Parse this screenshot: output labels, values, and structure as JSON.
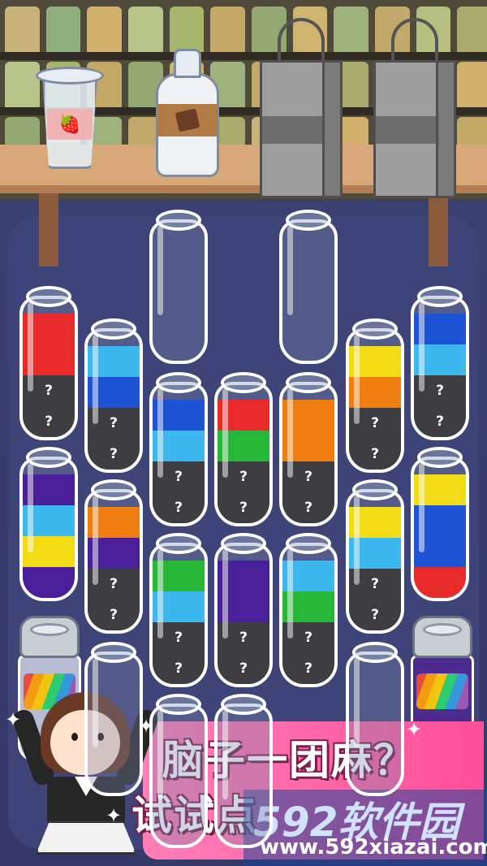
{
  "scene": {
    "shelf_items": [
      "strawberry-cup",
      "chocolate-milk-bottle",
      "shopping-bag",
      "shopping-bag"
    ],
    "colors": {
      "red": "#e82a2a",
      "light_blue": "#3cb8ef",
      "blue": "#1e53d6",
      "green": "#27b83a",
      "orange": "#f07d10",
      "yellow": "#f2dc16",
      "purple": "#4a1f9a",
      "hidden": "#3e3e42"
    }
  },
  "tubes": [
    {
      "id": "t1",
      "segments": [
        {
          "color": "red"
        },
        {
          "color": "red"
        },
        {
          "hidden": true,
          "mark": "?"
        },
        {
          "hidden": true,
          "mark": "?"
        }
      ]
    },
    {
      "id": "t2",
      "segments": [
        {
          "color": "light_blue"
        },
        {
          "color": "blue"
        },
        {
          "hidden": true,
          "mark": "?"
        },
        {
          "hidden": true,
          "mark": "?"
        }
      ]
    },
    {
      "id": "t3",
      "segments": []
    },
    {
      "id": "t4",
      "segments": [
        {
          "color": "blue"
        },
        {
          "color": "light_blue"
        },
        {
          "hidden": true,
          "mark": "?"
        },
        {
          "hidden": true,
          "mark": "?"
        }
      ]
    },
    {
      "id": "t5",
      "segments": [
        {
          "color": "red"
        },
        {
          "color": "green"
        },
        {
          "hidden": true,
          "mark": "?"
        },
        {
          "hidden": true,
          "mark": "?"
        }
      ]
    },
    {
      "id": "t6",
      "segments": []
    },
    {
      "id": "t7",
      "segments": [
        {
          "color": "orange"
        },
        {
          "color": "orange"
        },
        {
          "hidden": true,
          "mark": "?"
        },
        {
          "hidden": true,
          "mark": "?"
        }
      ]
    },
    {
      "id": "t8",
      "segments": [
        {
          "color": "yellow"
        },
        {
          "color": "orange"
        },
        {
          "hidden": true,
          "mark": "?"
        },
        {
          "hidden": true,
          "mark": "?"
        }
      ]
    },
    {
      "id": "t9",
      "segments": [
        {
          "color": "blue"
        },
        {
          "color": "light_blue"
        },
        {
          "hidden": true,
          "mark": "?"
        },
        {
          "hidden": true,
          "mark": "?"
        }
      ]
    },
    {
      "id": "t10",
      "segments": [
        {
          "color": "purple"
        },
        {
          "color": "light_blue"
        },
        {
          "color": "yellow"
        },
        {
          "color": "purple"
        }
      ]
    },
    {
      "id": "t11",
      "segments": [
        {
          "color": "orange"
        },
        {
          "color": "purple"
        },
        {
          "hidden": true,
          "mark": "?"
        },
        {
          "hidden": true,
          "mark": "?"
        }
      ]
    },
    {
      "id": "t12",
      "segments": [
        {
          "color": "green"
        },
        {
          "color": "light_blue"
        },
        {
          "hidden": true,
          "mark": "?"
        },
        {
          "hidden": true,
          "mark": "?"
        }
      ]
    },
    {
      "id": "t13",
      "segments": [
        {
          "color": "purple"
        },
        {
          "color": "purple"
        },
        {
          "hidden": true,
          "mark": "?"
        },
        {
          "hidden": true,
          "mark": "?"
        }
      ]
    },
    {
      "id": "t14",
      "segments": [
        {
          "color": "light_blue"
        },
        {
          "color": "green"
        },
        {
          "hidden": true,
          "mark": "?"
        },
        {
          "hidden": true,
          "mark": "?"
        }
      ]
    },
    {
      "id": "t15",
      "segments": [
        {
          "color": "yellow"
        },
        {
          "color": "light_blue"
        },
        {
          "hidden": true,
          "mark": "?"
        },
        {
          "hidden": true,
          "mark": "?"
        }
      ]
    },
    {
      "id": "t16",
      "segments": [
        {
          "color": "yellow"
        },
        {
          "color": "blue"
        },
        {
          "color": "blue"
        },
        {
          "color": "red"
        }
      ]
    },
    {
      "id": "t17",
      "segments": []
    },
    {
      "id": "t18",
      "segments": []
    },
    {
      "id": "t19",
      "segments": []
    },
    {
      "id": "t20",
      "segments": []
    }
  ],
  "promo": {
    "line1": "脑子一团麻？",
    "line2": "试试点",
    "watermark_logo": "592软件园",
    "watermark_url": "www.592xiazai.com"
  }
}
